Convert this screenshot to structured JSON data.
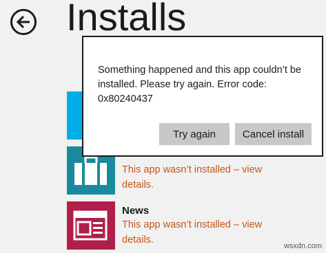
{
  "header": {
    "title": "Installs",
    "back_icon": "back-arrow-icon"
  },
  "apps": [
    {
      "name": "",
      "status": "This app wasn’t installed – view details.",
      "tile_color": "#1a8b9e",
      "icon": "shopping-bag-icon"
    },
    {
      "name": "News",
      "status": "This app wasn’t installed – view details.",
      "tile_color": "#b01e4a",
      "icon": "newspaper-icon"
    }
  ],
  "dialog": {
    "message": "Something happened and this app couldn’t be installed. Please try again. Error code: 0x80240437",
    "primary_button": "Try again",
    "secondary_button": "Cancel install"
  },
  "watermark": "wsxdn.com",
  "colors": {
    "status_text": "#c5561a",
    "partial_tile": "#00aee8"
  }
}
